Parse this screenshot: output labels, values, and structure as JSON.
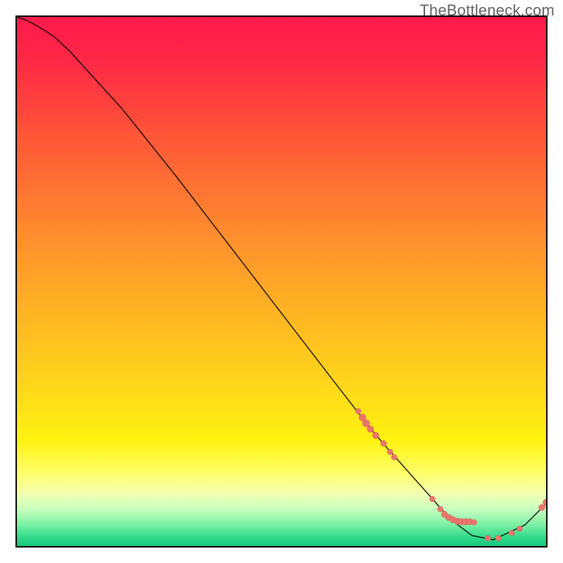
{
  "watermark": "TheBottleneck.com",
  "chart_data": {
    "type": "line",
    "title": "",
    "xlabel": "",
    "ylabel": "",
    "xlim": [
      0,
      100
    ],
    "ylim": [
      0,
      100
    ],
    "grid": false,
    "legend": false,
    "background_gradient": {
      "stops": [
        {
          "offset": 0.0,
          "color": "#ff1a4a"
        },
        {
          "offset": 0.08,
          "color": "#ff2746"
        },
        {
          "offset": 0.22,
          "color": "#ff5438"
        },
        {
          "offset": 0.4,
          "color": "#ff8a2e"
        },
        {
          "offset": 0.55,
          "color": "#ffb223"
        },
        {
          "offset": 0.7,
          "color": "#ffd81a"
        },
        {
          "offset": 0.8,
          "color": "#fff210"
        },
        {
          "offset": 0.86,
          "color": "#ffff66"
        },
        {
          "offset": 0.9,
          "color": "#f3ffb0"
        },
        {
          "offset": 0.93,
          "color": "#c9ffc0"
        },
        {
          "offset": 0.96,
          "color": "#7af0a3"
        },
        {
          "offset": 0.985,
          "color": "#2cd88a"
        },
        {
          "offset": 1.0,
          "color": "#18c77c"
        }
      ]
    },
    "series": [
      {
        "name": "bottleneck-curve",
        "x": [
          0.0,
          2.0,
          4.0,
          7.0,
          10.0,
          20.0,
          30.0,
          40.0,
          50.0,
          60.0,
          67.0,
          70.0,
          74.0,
          78.0,
          82.0,
          86.0,
          90.0,
          96.0,
          100.0
        ],
        "y": [
          100.0,
          99.3,
          98.2,
          96.3,
          93.5,
          82.5,
          70.0,
          57.0,
          44.0,
          31.0,
          22.0,
          18.5,
          14.0,
          9.5,
          5.0,
          2.0,
          1.2,
          4.0,
          8.0
        ]
      }
    ],
    "markers": [
      {
        "name": "cluster-mid",
        "points": [
          {
            "x": 64.5,
            "y": 25.5,
            "r": 4.0
          },
          {
            "x": 65.3,
            "y": 24.3,
            "r": 5.0
          },
          {
            "x": 66.0,
            "y": 23.2,
            "r": 5.2
          },
          {
            "x": 66.8,
            "y": 22.1,
            "r": 4.6
          },
          {
            "x": 67.8,
            "y": 20.9,
            "r": 4.5
          },
          {
            "x": 69.3,
            "y": 19.4,
            "r": 4.2
          },
          {
            "x": 70.5,
            "y": 17.8,
            "r": 4.0
          },
          {
            "x": 71.3,
            "y": 16.8,
            "r": 4.0
          }
        ]
      },
      {
        "name": "cluster-valley",
        "points": [
          {
            "x": 78.5,
            "y": 8.9,
            "r": 4.0
          },
          {
            "x": 80.0,
            "y": 7.0,
            "r": 4.0
          },
          {
            "x": 80.8,
            "y": 6.0,
            "r": 4.5
          },
          {
            "x": 81.6,
            "y": 5.4,
            "r": 4.6
          },
          {
            "x": 82.4,
            "y": 5.0,
            "r": 4.6
          },
          {
            "x": 83.2,
            "y": 4.7,
            "r": 4.6
          },
          {
            "x": 84.0,
            "y": 4.6,
            "r": 4.6
          },
          {
            "x": 84.8,
            "y": 4.6,
            "r": 4.6
          },
          {
            "x": 85.6,
            "y": 4.6,
            "r": 4.5
          },
          {
            "x": 86.4,
            "y": 4.5,
            "r": 4.0
          },
          {
            "x": 89.0,
            "y": 1.5,
            "r": 4.0
          },
          {
            "x": 91.0,
            "y": 1.5,
            "r": 4.0
          },
          {
            "x": 93.5,
            "y": 2.5,
            "r": 4.0
          },
          {
            "x": 95.0,
            "y": 3.3,
            "r": 4.0
          }
        ]
      },
      {
        "name": "cluster-tail",
        "points": [
          {
            "x": 99.2,
            "y": 7.3,
            "r": 4.5
          },
          {
            "x": 100.0,
            "y": 8.3,
            "r": 4.5
          }
        ]
      }
    ]
  }
}
